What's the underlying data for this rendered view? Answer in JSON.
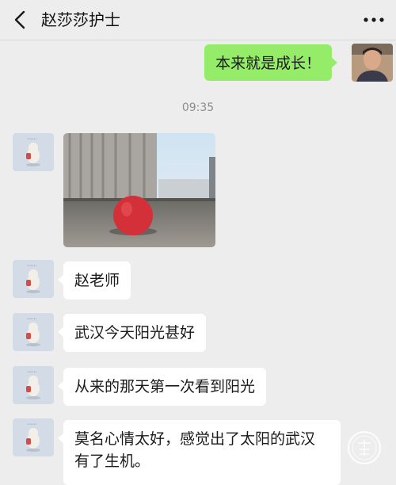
{
  "header": {
    "title": "赵莎莎护士"
  },
  "colors": {
    "background": "#ededed",
    "bubble_in": "#ffffff",
    "bubble_out": "#95ec69",
    "timestamp": "#8c8c8c"
  },
  "icons": {
    "back": "chevron-left-icon",
    "more": "more-dots-icon",
    "watermark": "watermark-stamp-icon"
  },
  "messages": {
    "sent": {
      "text": "本来就是成长！"
    },
    "time": "09:35",
    "received": [
      {
        "type": "image",
        "alt": ""
      },
      {
        "type": "text",
        "text": "赵老师"
      },
      {
        "type": "text",
        "text": "武汉今天阳光甚好"
      },
      {
        "type": "text",
        "text": "从来的那天第一次看到阳光"
      },
      {
        "type": "text",
        "text": "莫名心情太好，感觉出了太阳的武汉有了生机。"
      }
    ]
  }
}
